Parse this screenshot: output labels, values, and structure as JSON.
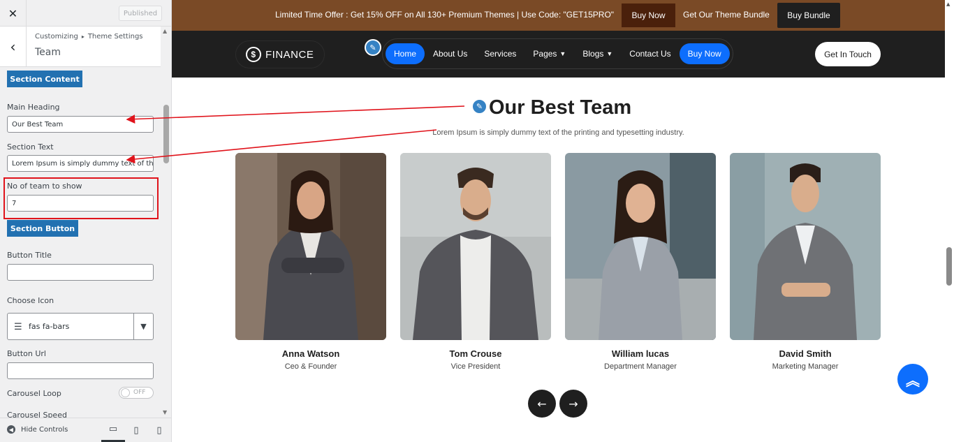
{
  "sidebar": {
    "close_label": "✕",
    "published_label": "Published",
    "breadcrumb_root": "Customizing",
    "breadcrumb_sep": "▸",
    "breadcrumb_parent": "Theme Settings",
    "section_title": "Team",
    "section_content_button": "Section Content",
    "main_heading_label": "Main Heading",
    "main_heading_value": "Our Best Team",
    "section_text_label": "Section Text",
    "section_text_value": "Lorem Ipsum is simply dummy text of the printing and typesetting industry.",
    "team_count_label": "No of team to show",
    "team_count_value": "7",
    "section_button_button": "Section Button",
    "button_title_label": "Button Title",
    "button_title_value": "",
    "choose_icon_label": "Choose Icon",
    "choose_icon_value": "fas fa-bars",
    "button_url_label": "Button Url",
    "button_url_value": "",
    "carousel_loop_label": "Carousel Loop",
    "carousel_loop_state": "OFF",
    "carousel_speed_label": "Carousel Speed",
    "hide_controls_label": "Hide Controls"
  },
  "promo": {
    "text": "Limited Time Offer : Get 15% OFF on All 130+ Premium Themes | Use Code: \"GET15PRO\"",
    "buy_now": "Buy Now",
    "bundle_text": "Get Our Theme Bundle",
    "buy_bundle": "Buy Bundle",
    "bg_color": "#7a4a26"
  },
  "nav": {
    "logo_text": "FINANCE",
    "items": [
      "Home",
      "About Us",
      "Services",
      "Pages",
      "Blogs",
      "Contact Us",
      "Buy Now"
    ],
    "get_in_touch": "Get In Touch",
    "accent_color": "#0d6efd"
  },
  "team": {
    "heading": "Our Best Team",
    "text": "Lorem Ipsum is simply dummy text of the printing and typesetting industry.",
    "members": [
      {
        "name": "Anna Watson",
        "role": "Ceo & Founder"
      },
      {
        "name": "Tom Crouse",
        "role": "Vice President"
      },
      {
        "name": "William lucas",
        "role": "Department Manager"
      },
      {
        "name": "David Smith",
        "role": "Marketing Manager"
      }
    ]
  },
  "icons": {
    "close": "close-icon",
    "back": "chevron-left-icon",
    "pencil": "pencil-icon",
    "prev": "arrow-left-icon",
    "next": "arrow-right-icon",
    "scroll_top": "double-chevron-up-icon"
  },
  "annotation_color": "#e0131b"
}
